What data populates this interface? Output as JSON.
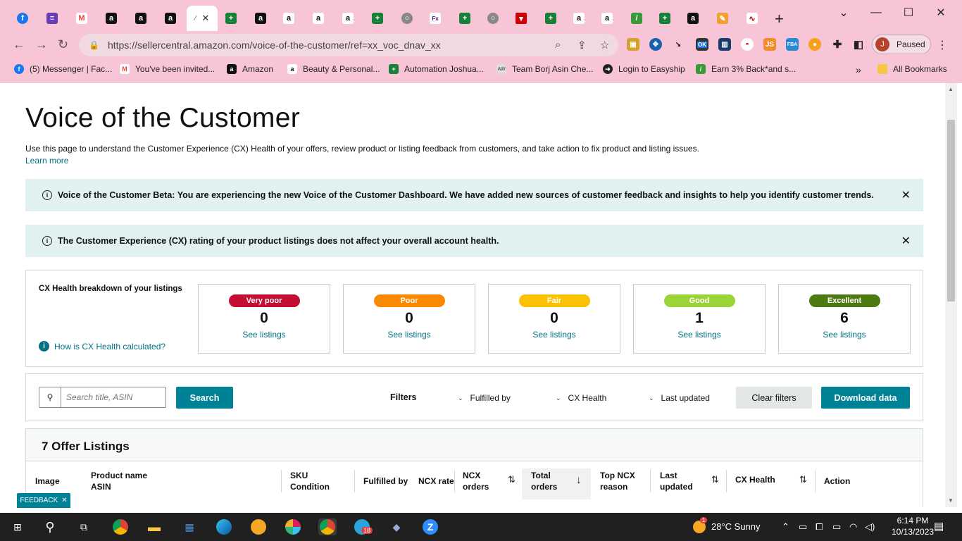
{
  "browser": {
    "tab_close": "✕",
    "new_tab": "+",
    "window_controls": {
      "minimize": "—",
      "maximize": "☐",
      "close": "✕",
      "tab_search": "⌄"
    },
    "url_host": "https://sellercentral.amazon.com",
    "url_path": "/voice-of-the-customer/ref=xx_voc_dnav_xx",
    "profile_initial": "J",
    "profile_status": "Paused",
    "extension_badge": "OK",
    "extension_js": "JS",
    "extension_fba": "FBA",
    "bookmarks": [
      {
        "label": "(5) Messenger | Fac...",
        "icon": "facebook-icon",
        "color": "#1877f2"
      },
      {
        "label": "You've been invited...",
        "icon": "gmail-icon",
        "color": "#ea4335"
      },
      {
        "label": "Amazon",
        "icon": "amazon-icon",
        "color": "#111111"
      },
      {
        "label": "Beauty & Personal...",
        "icon": "amazon-icon",
        "color": "#ffffff"
      },
      {
        "label": "Automation Joshua...",
        "icon": "sheets-icon",
        "color": "#188038"
      },
      {
        "label": "Team Borj Asin Che...",
        "icon": "team-icon",
        "color": "#999999"
      },
      {
        "label": "Login to Easyship",
        "icon": "easyship-icon",
        "color": "#222222"
      },
      {
        "label": "Earn 3% Back*and s...",
        "icon": "cashback-icon",
        "color": "#3a9a3a"
      }
    ],
    "more_bookmarks": "»",
    "all_bookmarks": "All Bookmarks"
  },
  "page": {
    "title": "Voice of the Customer",
    "description": "Use this page to understand the Customer Experience (CX) Health of your offers, review product or listing feedback from customers, and take action to fix product and listing issues.",
    "learn_more": "Learn more",
    "alerts": [
      {
        "text": "Voice of the Customer Beta: You are experiencing the new Voice of the Customer Dashboard. We have added new sources of customer feedback and insights to help you identify customer trends.",
        "icon": "info-icon"
      },
      {
        "text": "The Customer Experience (CX) rating of your product listings does not affect your overall account health.",
        "icon": "info-icon"
      }
    ],
    "alert_close": "✕",
    "cx": {
      "title": "CX Health breakdown of your listings",
      "how_link": "How is CX Health calculated?",
      "info_glyph": "i",
      "see_listings": "See listings",
      "cards": [
        {
          "label": "Very poor",
          "count": "0",
          "color": "#c40e33",
          "text_color": "#ffffff"
        },
        {
          "label": "Poor",
          "count": "0",
          "color": "#fa8900",
          "text_color": "#ffffff"
        },
        {
          "label": "Fair",
          "count": "0",
          "color": "#fcc105",
          "text_color": "#ffffff"
        },
        {
          "label": "Good",
          "count": "1",
          "color": "#9bd437",
          "text_color": "#ffffff"
        },
        {
          "label": "Excellent",
          "count": "6",
          "color": "#4d7a11",
          "text_color": "#ffffff"
        }
      ]
    },
    "search": {
      "placeholder": "Search title, ASIN",
      "button": "Search",
      "filters_label": "Filters",
      "filter_dropdowns": [
        "Fulfilled by",
        "CX Health",
        "Last updated"
      ],
      "clear": "Clear filters",
      "download": "Download data"
    },
    "listings": {
      "title": "7 Offer Listings",
      "columns": [
        {
          "l1": "Image",
          "l2": ""
        },
        {
          "l1": "Product name",
          "l2": "ASIN"
        },
        {
          "l1": "SKU",
          "l2": "Condition"
        },
        {
          "l1": "Fulfilled by",
          "l2": ""
        },
        {
          "l1": "NCX rate",
          "l2": ""
        },
        {
          "l1": "NCX",
          "l2": "orders"
        },
        {
          "l1": "Total",
          "l2": "orders"
        },
        {
          "l1": "Top NCX",
          "l2": "reason"
        },
        {
          "l1": "Last",
          "l2": "updated"
        },
        {
          "l1": "CX Health",
          "l2": ""
        },
        {
          "l1": "Action",
          "l2": ""
        }
      ]
    },
    "feedback_label": "FEEDBACK",
    "feedback_close": "✕"
  },
  "taskbar": {
    "notification_badge": "1",
    "weather": "28°C  Sunny",
    "telegram_badge": "18",
    "time": "6:14 PM",
    "date": "10/13/2023"
  },
  "colors": {
    "accent": "#008296",
    "link": "#007185",
    "alert_bg": "#e1f0f0",
    "chrome_bg": "#f7c5d6"
  }
}
